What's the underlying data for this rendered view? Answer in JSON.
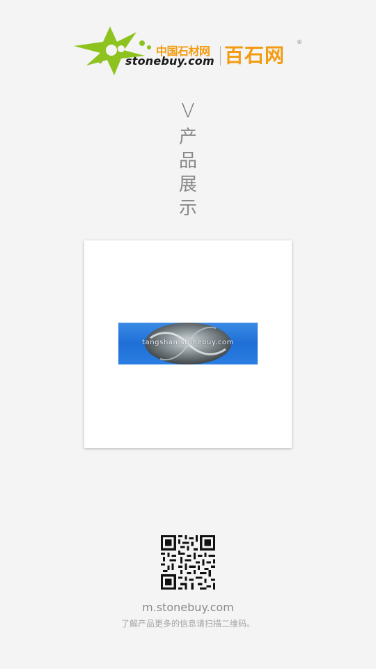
{
  "logo": {
    "cn_name": "中国石材网",
    "domain": "stonebuy.com",
    "brand": "百石网",
    "registered": "®",
    "brand_color": "#f39c12",
    "mark_color": "#8dc21f"
  },
  "section_title": {
    "letter": "V",
    "chars": [
      "产",
      "品",
      "展",
      "示"
    ]
  },
  "product": {
    "banner_text": "tangshan.stonebuy.com",
    "banner_color": "#2b7ee2"
  },
  "footer": {
    "qr_icon": "qr-code",
    "url": "m.stonebuy.com",
    "hint": "了解产品更多的信息请扫描二维码。"
  }
}
